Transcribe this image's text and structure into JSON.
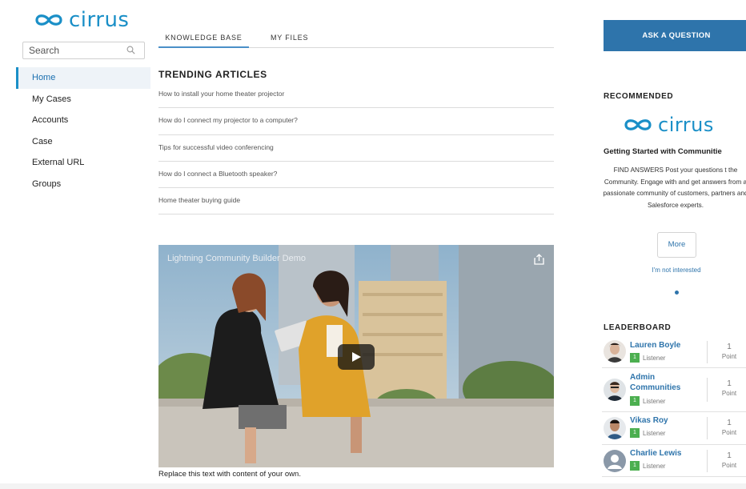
{
  "brand": {
    "name": "cirrus",
    "color": "#1a8fc7"
  },
  "search": {
    "placeholder": "Search"
  },
  "nav": {
    "items": [
      {
        "label": "Home",
        "active": true
      },
      {
        "label": "My Cases",
        "active": false
      },
      {
        "label": "Accounts",
        "active": false
      },
      {
        "label": "Case",
        "active": false
      },
      {
        "label": "External URL",
        "active": false
      },
      {
        "label": "Groups",
        "active": false
      }
    ]
  },
  "tabs": [
    {
      "label": "KNOWLEDGE BASE",
      "active": true
    },
    {
      "label": "MY FILES",
      "active": false
    }
  ],
  "trending": {
    "title": "TRENDING ARTICLES",
    "articles": [
      "How to install your home theater projector",
      "How do I connect my projector to a computer?",
      "Tips for successful video conferencing",
      "How do I connect a Bluetooth speaker?",
      "Home theater buying guide"
    ]
  },
  "video": {
    "title": "Lightning Community Builder Demo"
  },
  "caption": "Replace this text with content of your own.",
  "ask_button": "ASK A QUESTION",
  "recommended": {
    "title": "RECOMMENDED",
    "logo_text": "cirrus",
    "heading": "Getting Started with Communitie",
    "body": "FIND ANSWERS Post your questions t the Community. Engage with and get answers from a passionate community of customers, partners and Salesforce experts.",
    "more_label": "More",
    "not_interested_label": "I'm not interested"
  },
  "leaderboard": {
    "title": "LEADERBOARD",
    "entries": [
      {
        "name": "Lauren Boyle",
        "level": "1",
        "rank": "Listener",
        "points": "1",
        "points_label": "Point"
      },
      {
        "name": "Admin Communities",
        "level": "1",
        "rank": "Listener",
        "points": "1",
        "points_label": "Point"
      },
      {
        "name": "Vikas Roy",
        "level": "1",
        "rank": "Listener",
        "points": "1",
        "points_label": "Point"
      },
      {
        "name": "Charlie Lewis",
        "level": "1",
        "rank": "Listener",
        "points": "1",
        "points_label": "Point"
      }
    ]
  },
  "colors": {
    "accent": "#2e74ab",
    "badge": "#4caf50",
    "active_nav_bg": "#eef3f8"
  }
}
